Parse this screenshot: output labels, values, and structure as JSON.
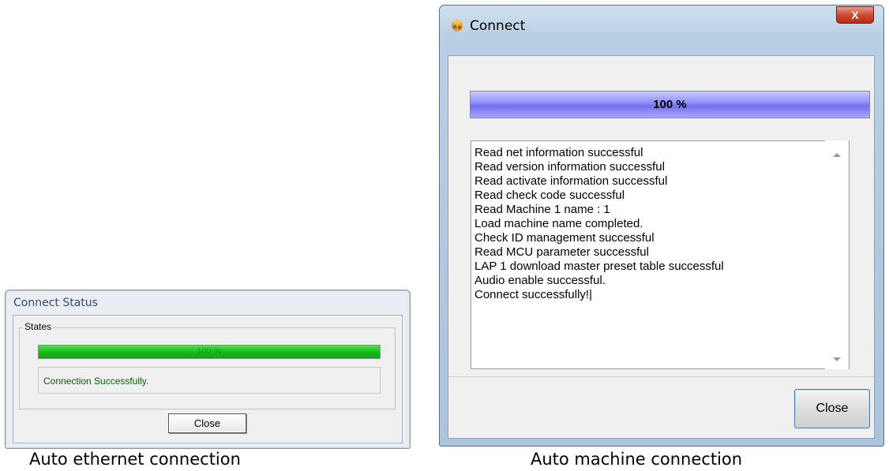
{
  "ethernet_dialog": {
    "title": "Connect Status",
    "group_label": "States",
    "progress_text": "100 %",
    "progress_fraction": 1.0,
    "message": "Connection Successfully.",
    "close_label": "Close",
    "caption": "Auto ethernet connection"
  },
  "machine_dialog": {
    "title": "Connect",
    "close_x": "X",
    "progress_text": "100 %",
    "progress_fraction": 1.0,
    "log_lines": [
      "Read net information successful",
      "Read version information successful",
      "Read activate information successful",
      "Read check code successful",
      "Read Machine 1 name : 1",
      "Load machine name completed.",
      "Check ID management successful",
      "Read MCU parameter successful",
      "LAP 1 download master preset table successful",
      "Audio enable successful.",
      "Connect successfully!|"
    ],
    "close_label": "Close",
    "caption": "Auto machine connection"
  },
  "icons": {
    "app_icon": "connect-app-icon",
    "scroll_up": "scroll-up-arrow-icon",
    "scroll_down": "scroll-down-arrow-icon"
  },
  "colors": {
    "ethernet_progress": "#17b817",
    "machine_progress": "#8e8cf8",
    "close_x_button": "#cc4b32"
  }
}
